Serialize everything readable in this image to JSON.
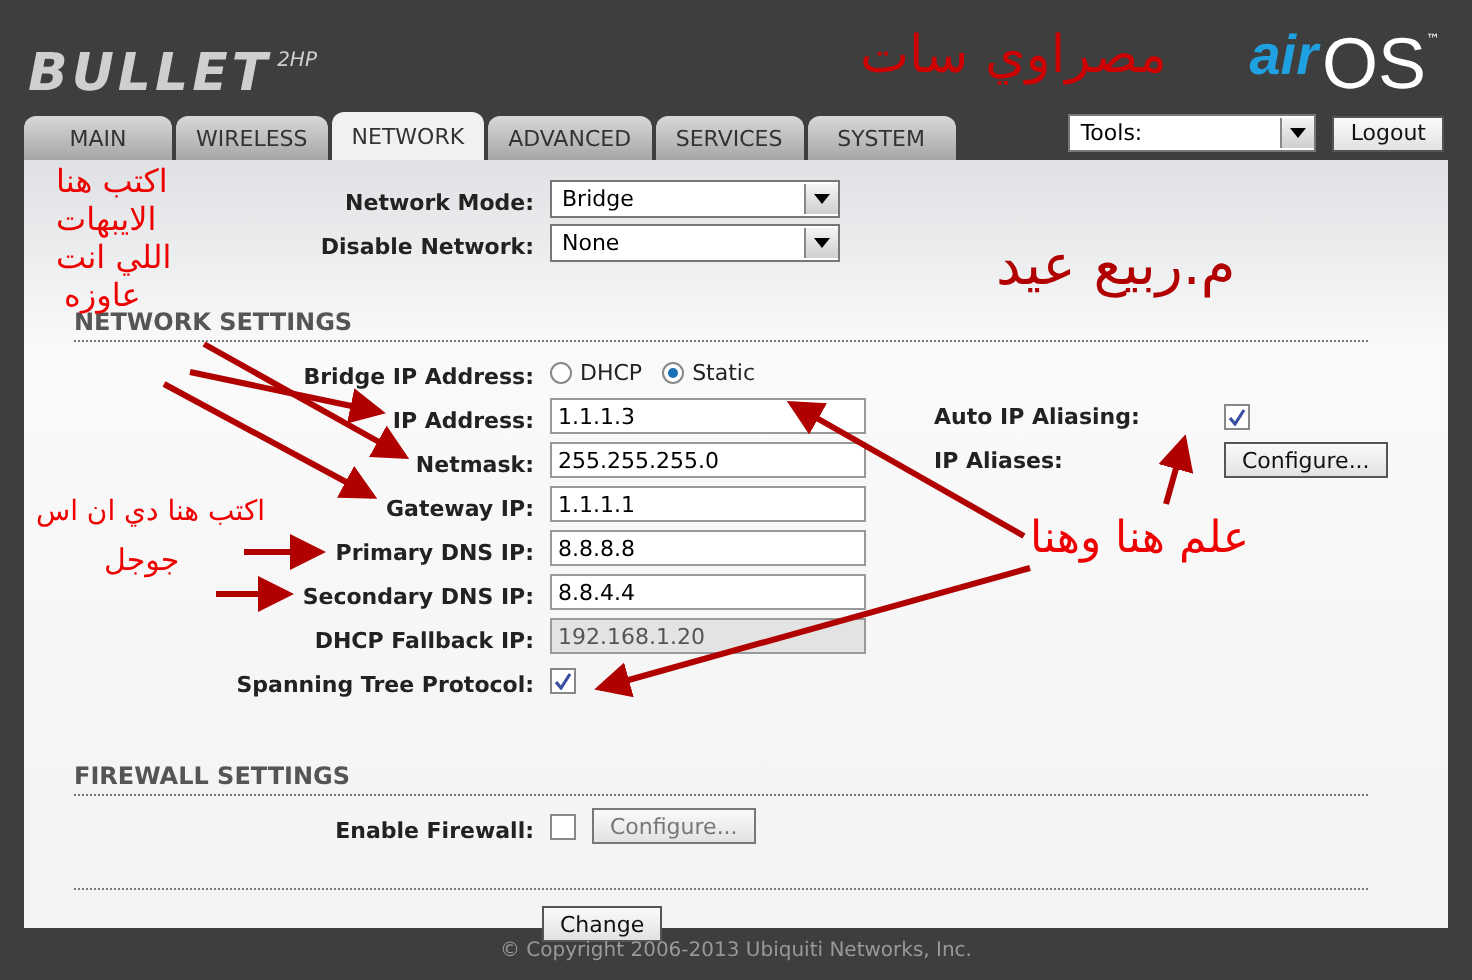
{
  "header": {
    "brand": "BULLET",
    "model": "2HP",
    "logo_air": "air",
    "logo_os": "OS",
    "logo_tm": "™"
  },
  "tabs": [
    {
      "label": "MAIN",
      "selected": false
    },
    {
      "label": "WIRELESS",
      "selected": false
    },
    {
      "label": "NETWORK",
      "selected": true
    },
    {
      "label": "ADVANCED",
      "selected": false
    },
    {
      "label": "SERVICES",
      "selected": false
    },
    {
      "label": "SYSTEM",
      "selected": false
    }
  ],
  "tools": {
    "value": "Tools:"
  },
  "logout": "Logout",
  "top_rows": [
    {
      "label": "Network Mode:",
      "kind": "select",
      "value": "Bridge"
    },
    {
      "label": "Disable Network:",
      "kind": "select",
      "value": "None"
    }
  ],
  "network_settings": {
    "title": "NETWORK SETTINGS",
    "rows": [
      {
        "label": "Bridge IP Address:",
        "kind": "radio",
        "options": [
          {
            "label": "DHCP",
            "selected": false
          },
          {
            "label": "Static",
            "selected": true
          }
        ]
      },
      {
        "label": "IP Address:",
        "kind": "text",
        "value": "1.1.1.3",
        "disabled": false,
        "side": {
          "label": "Auto IP Aliasing:",
          "kind": "checkbox",
          "checked": true
        }
      },
      {
        "label": "Netmask:",
        "kind": "text",
        "value": "255.255.255.0",
        "disabled": false,
        "side": {
          "label": "IP Aliases:",
          "kind": "button",
          "text": "Configure..."
        }
      },
      {
        "label": "Gateway IP:",
        "kind": "text",
        "value": "1.1.1.1",
        "disabled": false
      },
      {
        "label": "Primary DNS IP:",
        "kind": "text",
        "value": "8.8.8.8",
        "disabled": false
      },
      {
        "label": "Secondary DNS IP:",
        "kind": "text",
        "value": "8.8.4.4",
        "disabled": false
      },
      {
        "label": "DHCP Fallback IP:",
        "kind": "text",
        "value": "192.168.1.20",
        "disabled": true
      },
      {
        "label": "Spanning Tree Protocol:",
        "kind": "checkbox",
        "checked": true
      }
    ]
  },
  "firewall_settings": {
    "title": "FIREWALL SETTINGS",
    "rows": [
      {
        "label": "Enable Firewall:",
        "kind": "checkbox",
        "checked": false,
        "button": {
          "text": "Configure...",
          "disabled": true
        }
      }
    ]
  },
  "change_button": "Change",
  "copyright": "© Copyright 2006-2013 Ubiquiti Networks, Inc.",
  "annotations": [
    {
      "text": "مصراوي سات"
    },
    {
      "text": "اكتب هنا"
    },
    {
      "text": "الايبهات"
    },
    {
      "text": "اللي انت"
    },
    {
      "text": "عاوزه"
    },
    {
      "text": "اكتب هنا دي ان اس"
    },
    {
      "text": "جوجل"
    },
    {
      "text": "م.ربيع عيد"
    },
    {
      "text": "علم هنا وهنا"
    }
  ]
}
